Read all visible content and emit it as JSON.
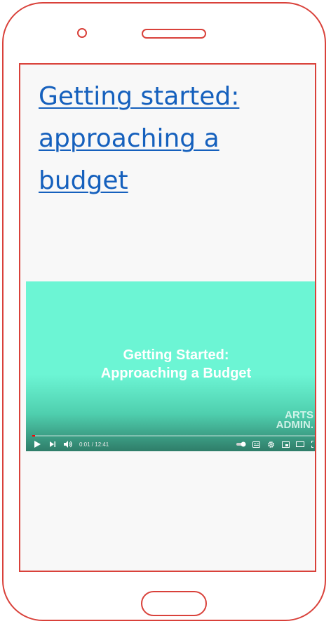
{
  "article": {
    "title": "Getting started: approaching a budget"
  },
  "video": {
    "title_line1": "Getting Started:",
    "title_line2": "Approaching a Budget",
    "logo_line1": "ARTS",
    "logo_line2": "ADMIN.",
    "time_display": "0:01 / 12:41",
    "progress_fraction": 0.0013
  },
  "icons": {
    "play": "play-icon",
    "next": "next-icon",
    "volume": "volume-icon",
    "autoplay": "autoplay-toggle-icon",
    "captions": "captions-icon",
    "settings": "gear-icon",
    "miniplayer": "miniplayer-icon",
    "theater": "theater-icon",
    "fullscreen": "fullscreen-icon"
  },
  "colors": {
    "frame": "#d9413a",
    "link": "#1560bd",
    "video_bg": "#6cf5d4"
  }
}
